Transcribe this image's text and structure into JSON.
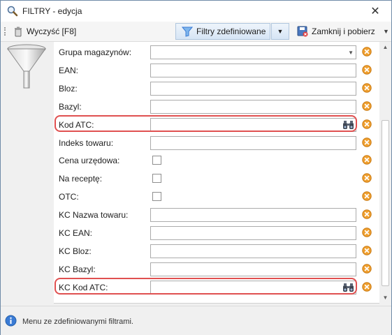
{
  "window": {
    "title": "FILTRY - edycja",
    "close_label": "✕"
  },
  "toolbar": {
    "clear_label": "Wyczyść [F8]",
    "defined_label": "Filtry zdefiniowane",
    "close_get_label": "Zamknij i pobierz"
  },
  "fields": [
    {
      "label": "Grupa magazynów:",
      "type": "combo",
      "value": ""
    },
    {
      "label": "EAN:",
      "type": "text",
      "value": ""
    },
    {
      "label": "Bloz:",
      "type": "text",
      "value": ""
    },
    {
      "label": "Bazyl:",
      "type": "text",
      "value": ""
    },
    {
      "label": "Kod ATC:",
      "type": "search",
      "value": "",
      "highlighted": true
    },
    {
      "label": "Indeks towaru:",
      "type": "text",
      "value": ""
    },
    {
      "label": "Cena urzędowa:",
      "type": "checkbox",
      "checked": false
    },
    {
      "label": "Na receptę:",
      "type": "checkbox",
      "checked": false
    },
    {
      "label": "OTC:",
      "type": "checkbox",
      "checked": false
    },
    {
      "label": "KC Nazwa towaru:",
      "type": "text",
      "value": ""
    },
    {
      "label": "KC EAN:",
      "type": "text",
      "value": ""
    },
    {
      "label": "KC Bloz:",
      "type": "text",
      "value": ""
    },
    {
      "label": "KC Bazyl:",
      "type": "text",
      "value": ""
    },
    {
      "label": "KC Kod ATC:",
      "type": "search",
      "value": "",
      "highlighted": true
    }
  ],
  "status": {
    "text": "Menu ze zdefiniowanymi filtrami."
  },
  "colors": {
    "accent": "#3a7bd5",
    "highlight": "#e05050",
    "clear_icon": "#f0a030"
  }
}
